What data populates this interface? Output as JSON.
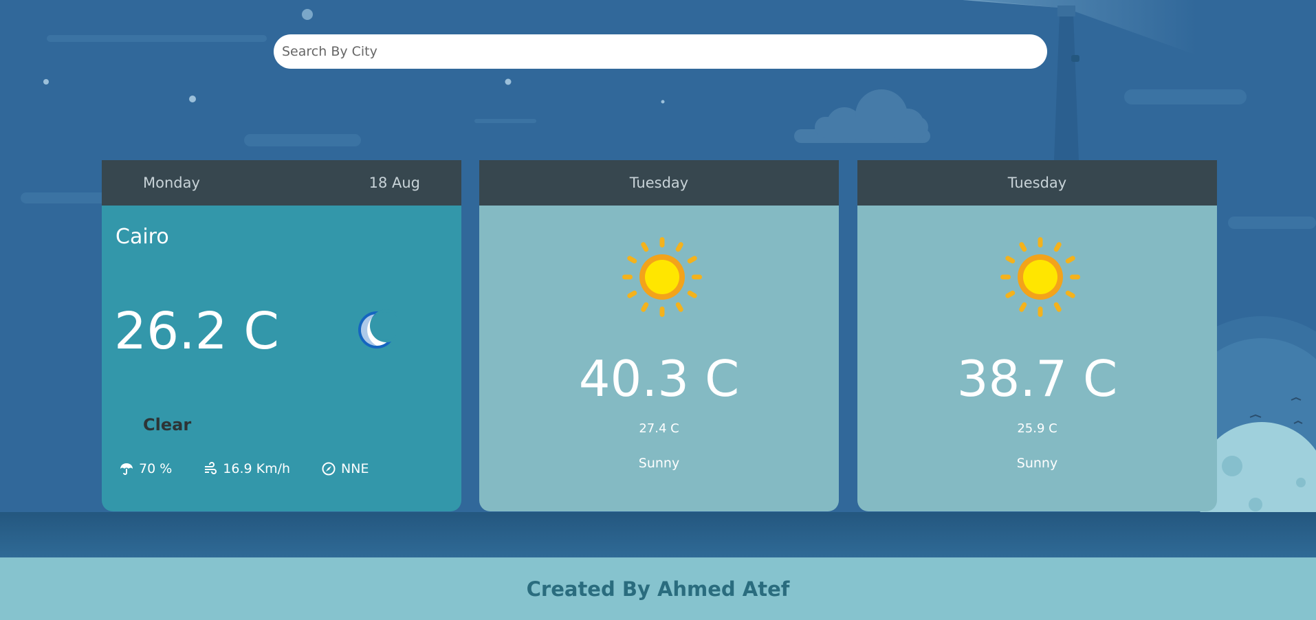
{
  "search": {
    "placeholder": "Search By City",
    "value": ""
  },
  "today": {
    "day": "Monday",
    "date": "18 Aug",
    "city": "Cairo",
    "temperature": "26.2 C",
    "condition": "Clear",
    "icon": "moon-icon",
    "humidity": "70 %",
    "wind_speed": "16.9 Km/h",
    "wind_direction": "NNE"
  },
  "forecast": [
    {
      "day": "Tuesday",
      "max": "40.3 C",
      "min": "27.4 C",
      "condition": "Sunny",
      "icon": "sun-icon"
    },
    {
      "day": "Tuesday",
      "max": "38.7 C",
      "min": "25.9 C",
      "condition": "Sunny",
      "icon": "sun-icon"
    }
  ],
  "footer": {
    "credit": "Created By Ahmed Atef"
  },
  "colors": {
    "background": "#31689a",
    "card_header": "#37474f",
    "today_card": "#3397aa",
    "forecast_card": "#84bac3",
    "footer": "#86c3ce",
    "footer_text": "#2a6c7e"
  }
}
